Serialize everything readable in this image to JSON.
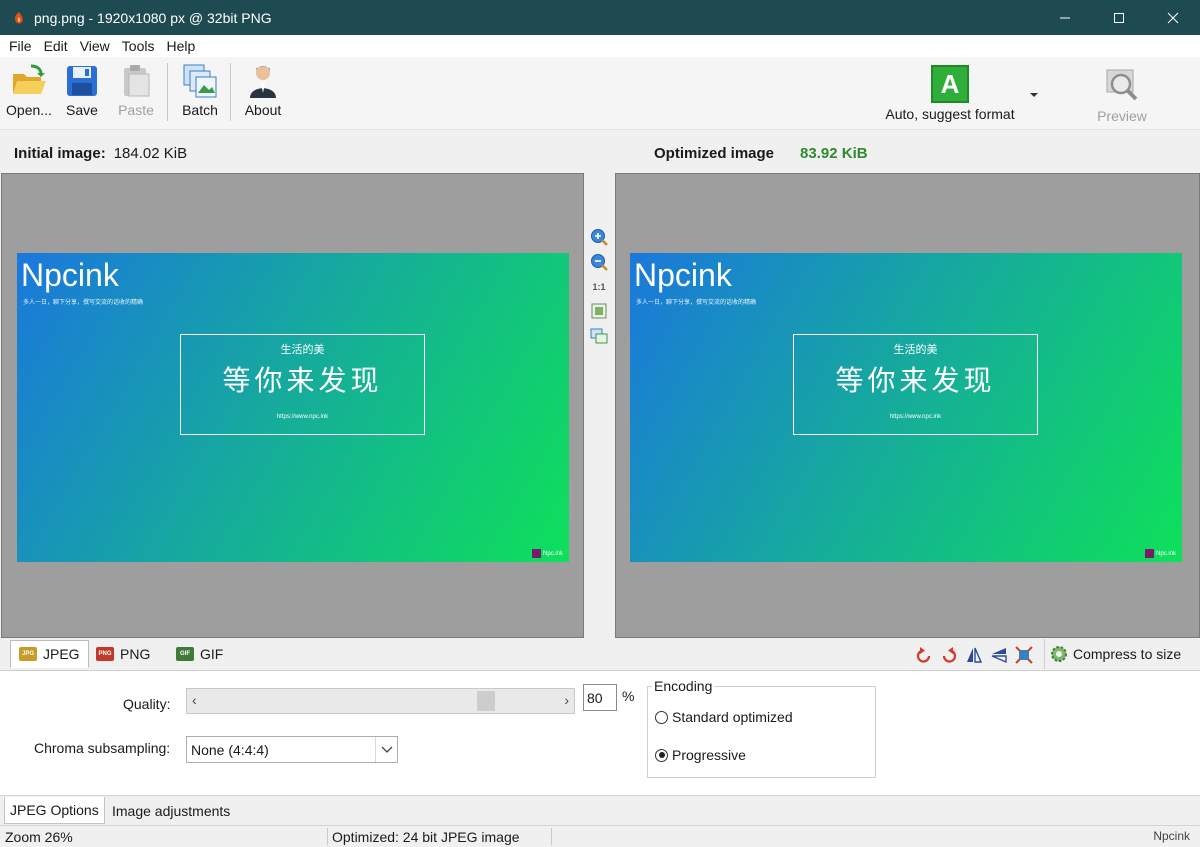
{
  "window": {
    "title": "png.png - 1920x1080 px @ 32bit PNG"
  },
  "menu": [
    "File",
    "Edit",
    "View",
    "Tools",
    "Help"
  ],
  "toolbar": {
    "open": "Open...",
    "save": "Save",
    "paste": "Paste",
    "batch": "Batch",
    "about": "About",
    "format_letter": "A",
    "format_label": "Auto, suggest format",
    "preview": "Preview"
  },
  "header": {
    "initial_label": "Initial image:",
    "initial_size": "184.02 KiB",
    "optimized_label": "Optimized image",
    "optimized_size": "83.92 KiB",
    "optimized_color": "#2e8b2e"
  },
  "zoom_tools": {
    "one_to_one": "1:1"
  },
  "preview_image": {
    "brand": "Npcink",
    "tagline": "多人一日，聊下分享，撰写交流的话收的精确",
    "subtitle": "生活的美",
    "headline": "等你来发现",
    "url": "https://www.npc.ink",
    "badge": "Npc.ink"
  },
  "format_tabs": [
    {
      "label": "JPEG",
      "icon": "jpeg-file-icon",
      "active": true
    },
    {
      "label": "PNG",
      "icon": "png-file-icon",
      "active": false
    },
    {
      "label": "GIF",
      "icon": "gif-file-icon",
      "active": false
    }
  ],
  "compress_label": "Compress to size",
  "jpeg_options": {
    "quality_label": "Quality:",
    "quality_value": "80",
    "quality_fraction": 0.8,
    "percent": "%",
    "chroma_label": "Chroma subsampling:",
    "chroma_value": "None (4:4:4)",
    "encoding_label": "Encoding",
    "radio_standard": "Standard optimized",
    "radio_progressive": "Progressive",
    "selected": "Progressive"
  },
  "bottom_tabs": [
    "JPEG Options",
    "Image adjustments"
  ],
  "status": {
    "zoom": "Zoom 26%",
    "optimized": "Optimized: 24 bit JPEG image",
    "watermark": "Npcink"
  }
}
